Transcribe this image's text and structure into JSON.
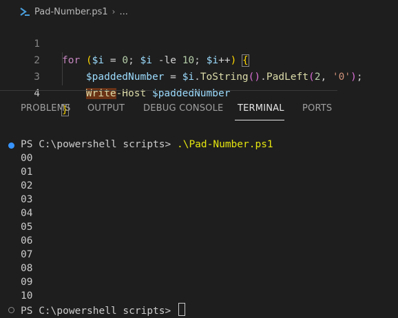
{
  "breadcrumb": {
    "icon": "powershell-icon",
    "file": "Pad-Number.ps1",
    "separator": "›",
    "more": "..."
  },
  "editor": {
    "lines": [
      {
        "number": "1",
        "code": "for ($i = 0; $i -le 10; $i++) {"
      },
      {
        "number": "2",
        "code": "$paddedNumber = $i.ToString().PadLeft(2, '0');"
      },
      {
        "number": "3",
        "code": "Write-Host $paddedNumber"
      },
      {
        "number": "4",
        "code": "}"
      }
    ]
  },
  "panel": {
    "tabs": [
      "PROBLEMS",
      "OUTPUT",
      "DEBUG CONSOLE",
      "TERMINAL",
      "PORTS"
    ],
    "active_tab": "TERMINAL"
  },
  "terminal": {
    "prompt": "PS C:\\powershell scripts>",
    "command": ".\\Pad-Number.ps1",
    "output": [
      "00",
      "01",
      "02",
      "03",
      "04",
      "05",
      "06",
      "07",
      "08",
      "09",
      "10"
    ],
    "final_prompt": "PS C:\\powershell scripts>"
  },
  "colors": {
    "background": "#1e1e1e",
    "keyword": "#c586c0",
    "variable": "#9cdcfe",
    "string": "#ce9178",
    "number": "#b5cea8",
    "command": "#e5e510",
    "status_dot": "#3794ff"
  }
}
